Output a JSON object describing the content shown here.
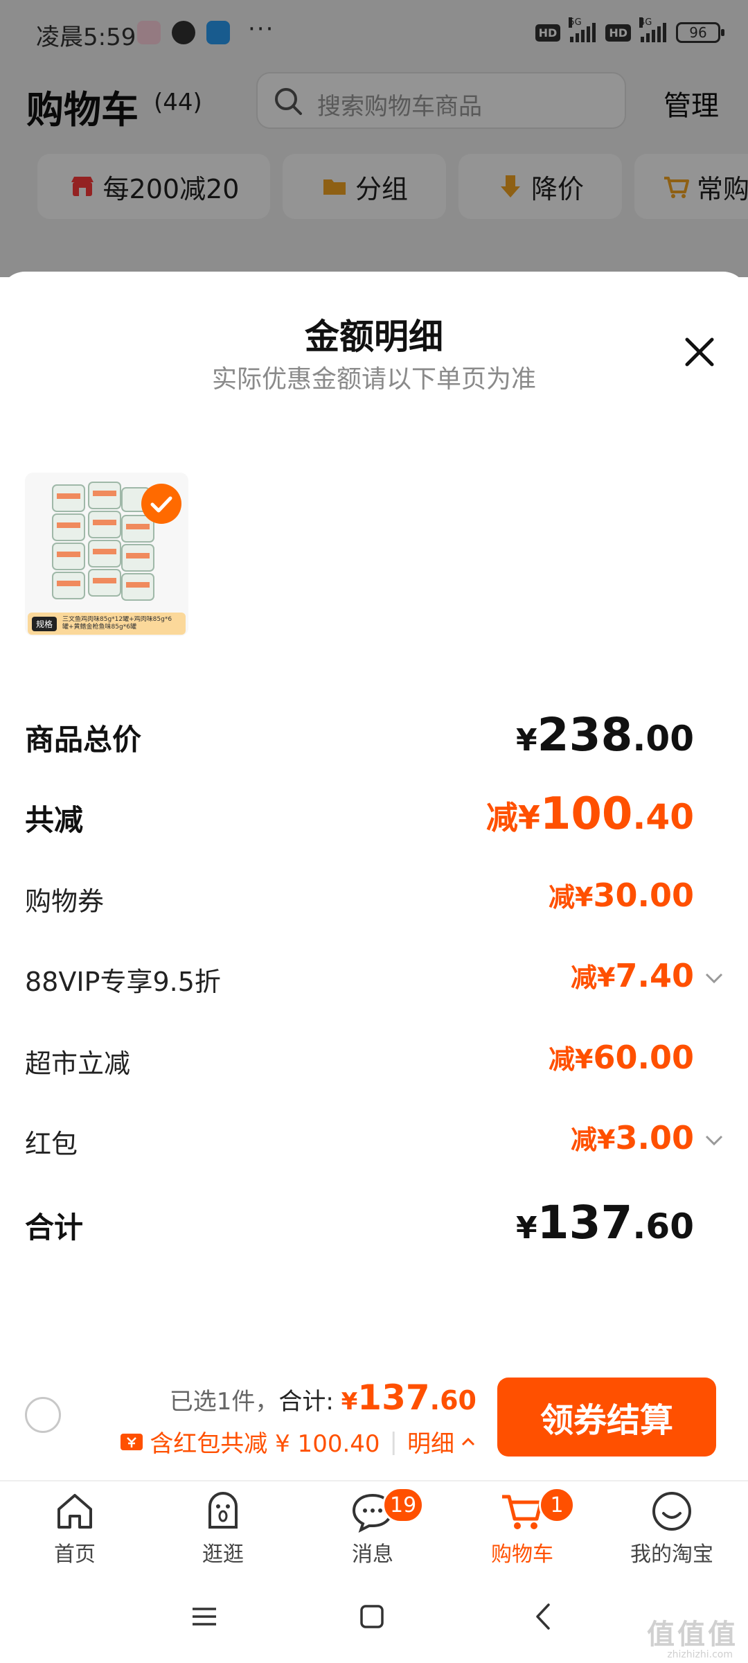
{
  "status": {
    "time": "凌晨5:59",
    "dots": "···",
    "hd1": "HD",
    "net1": "5G",
    "hd2": "HD",
    "net2": "4G",
    "battery": "96"
  },
  "header": {
    "title": "购物车",
    "count": "(44)",
    "search_placeholder": "搜索购物车商品",
    "manage": "管理"
  },
  "chips": [
    {
      "label": "每200减20",
      "icon": "store-icon"
    },
    {
      "label": "分组",
      "icon": "folder-icon"
    },
    {
      "label": "降价",
      "icon": "price-drop-icon"
    },
    {
      "label": "常购",
      "icon": "cart-icon"
    }
  ],
  "sheet": {
    "title": "金额明细",
    "subtitle": "实际优惠金额请以下单页为准",
    "product": {
      "spec_tag": "规格",
      "spec_text": "三文鱼鸡肉味85g*12罐+鸡肉味85g*6罐+黄鳍金枪鱼味85g*6罐"
    },
    "rows": {
      "total_price": {
        "label": "商品总价",
        "currency": "¥",
        "int": "238",
        "dec": ".00"
      },
      "total_discount": {
        "label": "共减",
        "prefix": "减",
        "currency": "¥",
        "int": "100",
        "dec": ".40"
      },
      "coupon": {
        "label": "购物券",
        "prefix": "减",
        "currency": "¥",
        "int": "30",
        "dec": ".00"
      },
      "vip": {
        "label": "88VIP专享9.5折",
        "prefix": "减",
        "currency": "¥",
        "int": "7",
        "dec": ".40"
      },
      "market": {
        "label": "超市立减",
        "prefix": "减",
        "currency": "¥",
        "int": "60",
        "dec": ".00"
      },
      "redpacket": {
        "label": "红包",
        "prefix": "减",
        "currency": "¥",
        "int": "3",
        "dec": ".00"
      },
      "subtotal": {
        "label": "合计",
        "currency": "¥",
        "int": "137",
        "dec": ".60"
      }
    }
  },
  "checkout": {
    "selected": "已选1件，",
    "sum_label": "合计: ",
    "sum_currency": "¥",
    "sum_int": "137",
    "sum_dec": ".60",
    "discount_text": "含红包共减 ¥ 100.40",
    "separator": "|",
    "detail": "明细",
    "button": "领券结算"
  },
  "tabs": [
    {
      "label": "首页",
      "icon": "home-icon"
    },
    {
      "label": "逛逛",
      "icon": "browse-icon"
    },
    {
      "label": "消息",
      "icon": "message-icon",
      "badge": "19"
    },
    {
      "label": "购物车",
      "icon": "cart-icon",
      "badge": "1",
      "active": true
    },
    {
      "label": "我的淘宝",
      "icon": "profile-icon"
    }
  ],
  "watermark": {
    "text": "值值值",
    "domain": "zhizhizhi.com"
  },
  "colors": {
    "accent": "#ff5000",
    "text": "#111111",
    "muted": "#8a8a8a"
  }
}
